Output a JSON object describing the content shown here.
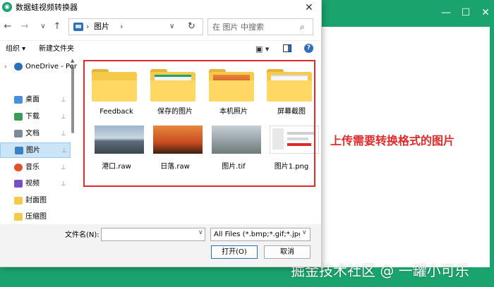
{
  "background_app": {
    "window_controls": {
      "minimize": "—",
      "maximize": "☐",
      "close": "✕"
    },
    "accent": "#1aa36c"
  },
  "annotation": {
    "text": "上传需要转换格式的图片",
    "color": "#e02a2a"
  },
  "watermark": "掘金技术社区 @ 一罐小可乐",
  "dialog": {
    "title": "数据蛙视频转换器",
    "close": "✕",
    "nav": {
      "back": "←",
      "forward": "→",
      "recent": "∨",
      "up": "↑"
    },
    "address": {
      "sep": "›",
      "location": "图片",
      "dropdown": "∨",
      "refresh": "↻"
    },
    "search": {
      "placeholder": "在 图片 中搜索",
      "icon": "⌕"
    },
    "toolbar": {
      "organize": "组织 ▾",
      "new_folder": "新建文件夹",
      "view": "▣ ▾",
      "help": "?"
    },
    "sidebar": {
      "items": [
        {
          "label": "OneDrive - Per",
          "icon": "cloud-icon",
          "color": "#2e6fb8",
          "pinned": false,
          "chevron": "›"
        },
        {
          "label": "桌面",
          "icon": "desktop-icon",
          "color": "#4a90d9",
          "pinned": true
        },
        {
          "label": "下载",
          "icon": "download-icon",
          "color": "#3b9c5a",
          "pinned": true
        },
        {
          "label": "文档",
          "icon": "document-icon",
          "color": "#7c8a99",
          "pinned": true
        },
        {
          "label": "图片",
          "icon": "pictures-icon",
          "color": "#3b7fc4",
          "pinned": true,
          "selected": true
        },
        {
          "label": "音乐",
          "icon": "music-icon",
          "color": "#e0522d",
          "pinned": true
        },
        {
          "label": "视频",
          "icon": "video-icon",
          "color": "#7b4fc4",
          "pinned": true
        },
        {
          "label": "封面图",
          "icon": "folder-icon",
          "color": "#f5c949",
          "pinned": false
        },
        {
          "label": "压缩图",
          "icon": "folder-icon",
          "color": "#f5c949",
          "pinned": false
        }
      ],
      "pin_glyph": "📌"
    },
    "files": [
      {
        "name": "Feedback",
        "kind": "folder",
        "preview": "empty"
      },
      {
        "name": "保存的图片",
        "kind": "folder",
        "preview": "screenshot"
      },
      {
        "name": "本机照片",
        "kind": "folder",
        "preview": "sunset"
      },
      {
        "name": "屏幕截图",
        "kind": "folder",
        "preview": "screenshot-light"
      },
      {
        "name": "港口.raw",
        "kind": "image",
        "preview": "harbor"
      },
      {
        "name": "日落.raw",
        "kind": "image",
        "preview": "sunset-birds"
      },
      {
        "name": "图片.tif",
        "kind": "image",
        "preview": "mountains"
      },
      {
        "name": "图片1.png",
        "kind": "image",
        "preview": "ui-screenshot"
      }
    ],
    "filename_label": "文件名(N):",
    "filename_value": "",
    "filter": "All Files (*.bmp;*.gif;*.jpg;*.jpeg)",
    "open_button": "打开(O)",
    "cancel_button": "取消"
  }
}
